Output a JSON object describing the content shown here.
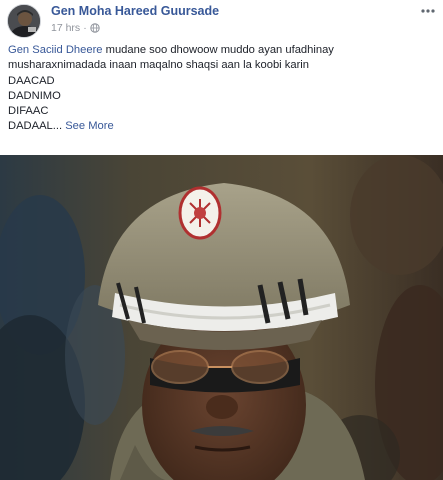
{
  "post": {
    "author": "Gen Moha Hareed Guursade",
    "timestamp": "17 hrs",
    "separator": "·",
    "privacy_icon": "globe-icon",
    "more_icon": "ellipsis-icon",
    "mention": "Gen Saciid Dheere",
    "text_line1_rest": " mudane soo dhowoow muddo ayan ufadhinay",
    "text_line2": "musharaxnimadada inaan maqalno shaqsi aan la koobi karin",
    "text_line3": "DAACAD",
    "text_line4": "DADNIMO",
    "text_line5": "DIFAAC",
    "text_line6": "DADAAL...",
    "see_more": "See More"
  },
  "colors": {
    "link": "#385898",
    "text": "#1d2129",
    "meta": "#90949c"
  }
}
